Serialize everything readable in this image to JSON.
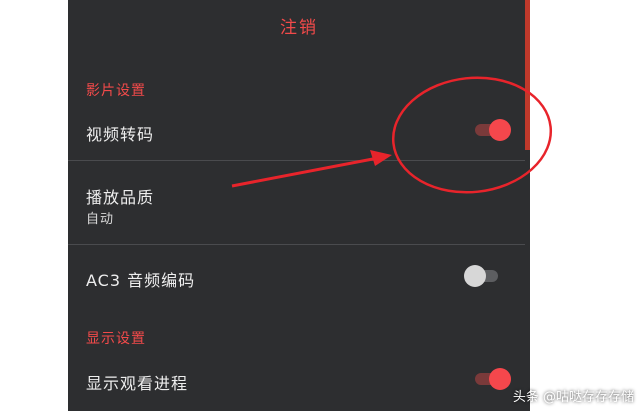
{
  "header": {
    "logout_label": "注销"
  },
  "video_settings": {
    "section_title": "影片设置",
    "transcode": {
      "label": "视频转码",
      "enabled": true
    },
    "quality": {
      "label": "播放品质",
      "value": "自动"
    },
    "ac3": {
      "label": "AC3 音频编码",
      "enabled": false
    }
  },
  "display_settings": {
    "section_title": "显示设置",
    "progress": {
      "label": "显示观看进程",
      "enabled": true
    }
  },
  "watermark": {
    "text": "头条 @咕哒存存存储"
  },
  "colors": {
    "panel_bg": "#2d2e30",
    "accent": "#f24a4a",
    "annotation": "#e8242b"
  }
}
